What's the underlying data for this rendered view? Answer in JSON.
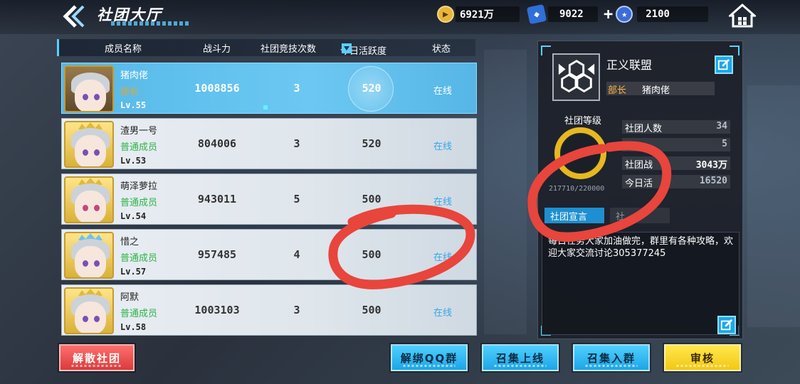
{
  "header": {
    "title": "社团大厅",
    "resources": {
      "coins": "6921万",
      "gems": "9022",
      "stars": "2100"
    }
  },
  "table": {
    "columns": {
      "name": "成员名称",
      "power": "战斗力",
      "arena": "社团竞技次数",
      "activity": "今日活跃度",
      "status": "状态"
    },
    "rows": [
      {
        "name": "猪肉佬",
        "role": "部长",
        "level": "Lv.55",
        "power": "1008856",
        "arena": "3",
        "activity": "520",
        "status": "在线"
      },
      {
        "name": "渣男一号",
        "role": "普通成员",
        "level": "Lv.53",
        "power": "804006",
        "arena": "3",
        "activity": "520",
        "status": "在线"
      },
      {
        "name": "萌泽萝拉",
        "role": "普通成员",
        "level": "Lv.54",
        "power": "943011",
        "arena": "5",
        "activity": "500",
        "status": "在线"
      },
      {
        "name": "惜之",
        "role": "普通成员",
        "level": "Lv.57",
        "power": "957485",
        "arena": "4",
        "activity": "500",
        "status": "在线"
      },
      {
        "name": "阿默",
        "role": "普通成员",
        "level": "Lv.58",
        "power": "1003103",
        "arena": "3",
        "activity": "500",
        "status": "在线"
      }
    ]
  },
  "buttons": {
    "disband": "解散社团",
    "unbind_qq": "解绑QQ群",
    "summon_online": "召集上线",
    "recruit": "召集入群",
    "review": "审核"
  },
  "club": {
    "name": "正义联盟",
    "leader_label": "部长",
    "leader_name": "猪肉佬",
    "level_label": "社团等级",
    "exp": "217710/220000",
    "stats": [
      {
        "label": "社团人数",
        "value": "34"
      },
      {
        "label": "",
        "value": "5"
      },
      {
        "label": "社团战",
        "value": "3043万"
      },
      {
        "label": "今日活",
        "value": "16520"
      }
    ],
    "tabs": {
      "declaration": "社团宣言",
      "other": "社"
    },
    "declaration": "每日任务大家加油做完，群里有各种攻略，欢迎大家交流讨论305377245"
  },
  "colors": {
    "accent": "#5ad0ff",
    "online": "#36a6e8",
    "leader": "#e6a52a",
    "member": "#2fb34a",
    "annotation": "#e8453c"
  }
}
